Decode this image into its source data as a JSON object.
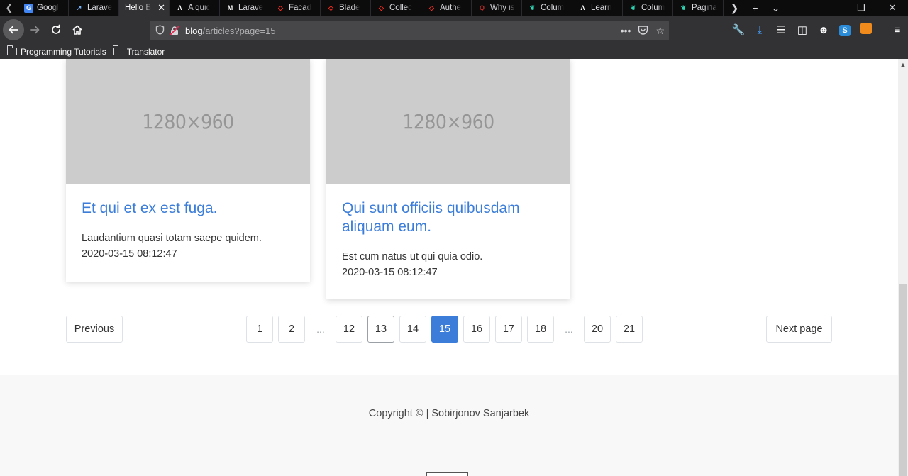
{
  "browser": {
    "tabs": [
      {
        "label": "Googl",
        "icon": "google-translate-icon",
        "color": "#4285f4",
        "active": false
      },
      {
        "label": "Larave",
        "icon": "feather-icon",
        "color": "#7ab8ff",
        "active": false
      },
      {
        "label": "Hello B",
        "icon": "",
        "color": "",
        "active": true
      },
      {
        "label": "A quic",
        "icon": "lambda-icon",
        "color": "#ffffff",
        "active": false
      },
      {
        "label": "Larave",
        "icon": "medium-icon",
        "color": "#ffffff",
        "active": false
      },
      {
        "label": "Facad",
        "icon": "laravel-icon",
        "color": "#ff2d20",
        "active": false
      },
      {
        "label": "Blade",
        "icon": "laravel-icon",
        "color": "#ff2d20",
        "active": false
      },
      {
        "label": "Collec",
        "icon": "laravel-icon",
        "color": "#ff2d20",
        "active": false
      },
      {
        "label": "Authe",
        "icon": "laravel-icon",
        "color": "#ff2d20",
        "active": false
      },
      {
        "label": "Why is",
        "icon": "quora-icon",
        "color": "#b92b27",
        "active": false
      },
      {
        "label": "Colum",
        "icon": "leaf-icon",
        "color": "#2fd2b0",
        "active": false
      },
      {
        "label": "Learn",
        "icon": "lambda-icon",
        "color": "#ffffff",
        "active": false
      },
      {
        "label": "Colum",
        "icon": "leaf-icon",
        "color": "#2fd2b0",
        "active": false
      },
      {
        "label": "Pagina",
        "icon": "leaf-icon",
        "color": "#2fd2b0",
        "active": false
      }
    ],
    "url": {
      "host": "blog",
      "path": "/articles?page=15"
    },
    "bookmarks": [
      {
        "label": "Programming Tutorials"
      },
      {
        "label": "Translator"
      }
    ]
  },
  "placeholder_text": "1280×960",
  "articles": [
    {
      "title": "Et qui et ex est fuga.",
      "excerpt": "Laudantium quasi totam saepe quidem.",
      "date": "2020-03-15 08:12:47"
    },
    {
      "title": "Qui sunt officiis quibusdam aliquam eum.",
      "excerpt": "Est cum natus ut qui quia odio.",
      "date": "2020-03-15 08:12:47"
    }
  ],
  "pagination": {
    "previous": "Previous",
    "next": "Next page",
    "pages": [
      "1",
      "2",
      "...",
      "12",
      "13",
      "14",
      "15",
      "16",
      "17",
      "18",
      "...",
      "20",
      "21"
    ],
    "current": "15"
  },
  "footer": {
    "copyright": "Copyright © | Sobirjonov Sanjarbek"
  },
  "colors": {
    "accent": "#3b7dd8"
  }
}
